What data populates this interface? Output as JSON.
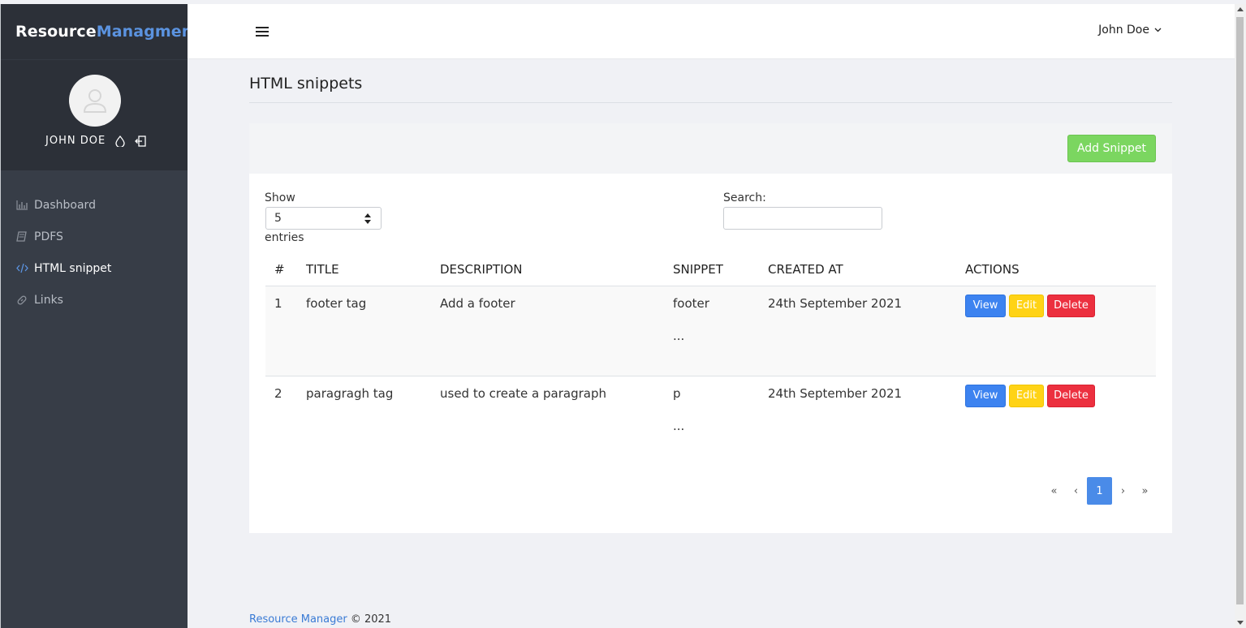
{
  "brand": {
    "part1": "Resource",
    "part2": "Managment"
  },
  "profile": {
    "name": "JOHN DOE"
  },
  "nav": [
    {
      "label": "Dashboard",
      "icon": "bar-chart-icon"
    },
    {
      "label": "PDFS",
      "icon": "book-icon"
    },
    {
      "label": "HTML snippet",
      "icon": "code-icon",
      "active": true
    },
    {
      "label": "Links",
      "icon": "link-icon"
    }
  ],
  "topbar": {
    "user": "John Doe"
  },
  "page": {
    "title": "HTML snippets"
  },
  "card": {
    "add_label": "Add Snippet"
  },
  "controls": {
    "show_label": "Show",
    "entries_value": "5",
    "entries_label": "entries",
    "search_label": "Search:",
    "search_value": ""
  },
  "table": {
    "headers": [
      "#",
      "TITLE",
      "DESCRIPTION",
      "SNIPPET",
      "CREATED AT",
      "ACTIONS"
    ],
    "rows": [
      {
        "num": "1",
        "title": "footer tag",
        "description": "Add a footer",
        "snippet": "footer",
        "snippet_more": "...",
        "created": "24th September 2021"
      },
      {
        "num": "2",
        "title": "paragragh tag",
        "description": "used to create a paragraph",
        "snippet": "p",
        "snippet_more": "...",
        "created": "24th September 2021"
      }
    ],
    "actions": {
      "view": "View",
      "edit": "Edit",
      "delete": "Delete"
    }
  },
  "pagination": {
    "first": "«",
    "prev": "‹",
    "current": "1",
    "next": "›",
    "last": "»"
  },
  "footer": {
    "link": "Resource Manager",
    "text": " © 2021"
  },
  "colors": {
    "sidebar": "#373d47",
    "brand_accent": "#5b93e0",
    "add_button": "#7bd660",
    "view_button": "#3d83f0",
    "edit_button": "#ffd316",
    "delete_button": "#ec303f",
    "page_active": "#4a8be8"
  }
}
